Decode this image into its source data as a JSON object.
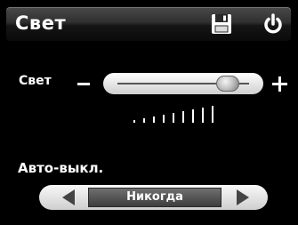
{
  "header": {
    "title": "Свет",
    "save_icon": "floppy-disk-icon",
    "power_icon": "power-icon"
  },
  "brightness": {
    "label": "Свет",
    "minus_icon": "minus-icon",
    "plus_icon": "plus-icon",
    "slider_level": 0.84,
    "level_bars_total": 9
  },
  "auto_off": {
    "label": "Авто-выкл.",
    "value": "Никогда",
    "prev_icon": "triangle-left-icon",
    "next_icon": "triangle-right-icon"
  },
  "colors": {
    "background": "#000000",
    "text": "#ffffff"
  }
}
